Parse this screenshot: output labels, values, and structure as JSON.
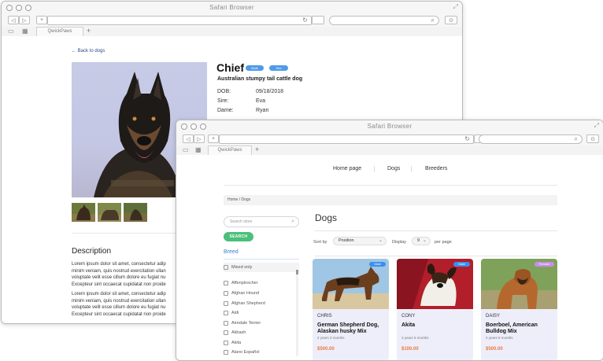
{
  "back_window": {
    "title": "Safari Browser",
    "tab": "QwickPaws",
    "back_link": "Back to dogs",
    "dog": {
      "name": "Chief",
      "badges": [
        "Male",
        "Sire"
      ],
      "breed": "Australian stumpy tail cattle dog",
      "details": [
        {
          "label": "DOB:",
          "value": "09/18/2018"
        },
        {
          "label": "Sire:",
          "value": "Eva"
        },
        {
          "label": "Dame:",
          "value": "Ryan"
        }
      ]
    },
    "description_heading": "Description",
    "paragraphs": [
      [
        "Lorem ipsum dolor sit amet, consectetur adip",
        "minim veniam, quis nostrud exercitation ullan",
        "voluptate velit esse cillum dolore eu fugiat nu",
        "Excepteur sint occaecat cupidatat non proide"
      ],
      [
        "Lorem ipsum dolor sit amet, consectetur adip",
        "minim veniam, quis nostrud exercitation ullan",
        "voluptate velit esse cillum dolore eu fugiat nu",
        "Excepteur sint occaecat cupidatat non proide"
      ]
    ]
  },
  "front_window": {
    "title": "Safari Browser",
    "tab": "QwickPaws",
    "nav": [
      "Home page",
      "Dogs",
      "Breeders"
    ],
    "breadcrumb": "Home  /  Dogs",
    "sidebar": {
      "search_placeholder": "Search store",
      "search_button": "SEARCH",
      "breed_heading": "Breed",
      "breeds": [
        "Mixed only",
        "Affenpinscher",
        "Afghan Hound",
        "Afghan Shepherd",
        "Aidi",
        "Airedale Terrier",
        "Akbash",
        "Akita",
        "Alano Español"
      ]
    },
    "main": {
      "heading": "Dogs",
      "sort_by_label": "Sort by",
      "sort_value": "Position",
      "display_label": "Display",
      "display_value": "9",
      "per_page_label": "per page"
    },
    "cards": [
      {
        "name": "CHRIS",
        "breed": "German Shepherd Dog, Alaskan husky Mix",
        "age": "2 years 3 months",
        "price": "$500.00",
        "badge": "Male",
        "badge_color": "#3b8ef0"
      },
      {
        "name": "CONY",
        "breed": "Akita",
        "age": "3 years 5 months",
        "price": "$100.00",
        "badge": "Male",
        "badge_color": "#3b8ef0"
      },
      {
        "name": "DAISY",
        "breed": "Boerboel, American Bulldog Mix",
        "age": "2 years 8 months",
        "price": "$500.00",
        "badge": "Female",
        "badge_color": "#c78ee8"
      }
    ]
  }
}
